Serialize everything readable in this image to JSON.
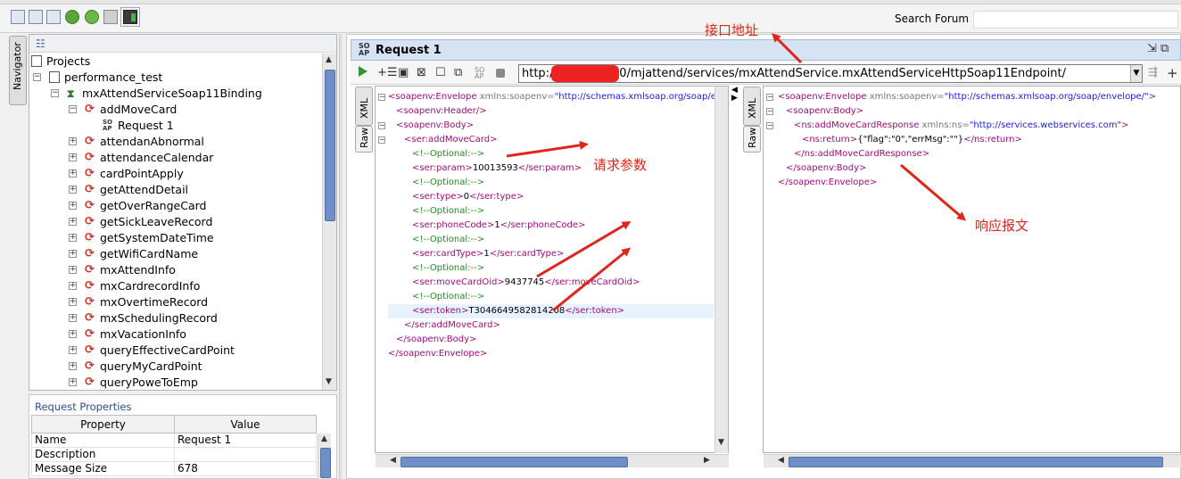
{
  "toolbar": {
    "icons": [
      "new-project-icon",
      "import-project-icon",
      "save-all-icon",
      "forum-icon",
      "sync-icon",
      "preferences-icon",
      "monitor-icon"
    ],
    "search_label": "Search Forum",
    "search_placeholder": ""
  },
  "navigator": {
    "tab_label": "Navigator",
    "tree": [
      {
        "label": "Projects",
        "level": 0,
        "icon": "projects-icon",
        "expander": ""
      },
      {
        "label": "performance_test",
        "level": 1,
        "icon": "project-icon",
        "expander": "−"
      },
      {
        "label": "mxAttendServiceSoap11Binding",
        "level": 2,
        "icon": "binding-icon",
        "expander": "−"
      },
      {
        "label": "addMoveCard",
        "level": 3,
        "icon": "operation-icon",
        "expander": "−"
      },
      {
        "label": "Request 1",
        "level": 4,
        "icon": "request-icon",
        "expander": ""
      },
      {
        "label": "attendanAbnormal",
        "level": 3,
        "icon": "operation-icon",
        "expander": "+"
      },
      {
        "label": "attendanceCalendar",
        "level": 3,
        "icon": "operation-icon",
        "expander": "+"
      },
      {
        "label": "cardPointApply",
        "level": 3,
        "icon": "operation-icon",
        "expander": "+"
      },
      {
        "label": "getAttendDetail",
        "level": 3,
        "icon": "operation-icon",
        "expander": "+"
      },
      {
        "label": "getOverRangeCard",
        "level": 3,
        "icon": "operation-icon",
        "expander": "+"
      },
      {
        "label": "getSickLeaveRecord",
        "level": 3,
        "icon": "operation-icon",
        "expander": "+"
      },
      {
        "label": "getSystemDateTime",
        "level": 3,
        "icon": "operation-icon",
        "expander": "+"
      },
      {
        "label": "getWifiCardName",
        "level": 3,
        "icon": "operation-icon",
        "expander": "+"
      },
      {
        "label": "mxAttendInfo",
        "level": 3,
        "icon": "operation-icon",
        "expander": "+"
      },
      {
        "label": "mxCardrecordInfo",
        "level": 3,
        "icon": "operation-icon",
        "expander": "+"
      },
      {
        "label": "mxOvertimeRecord",
        "level": 3,
        "icon": "operation-icon",
        "expander": "+"
      },
      {
        "label": "mxSchedulingRecord",
        "level": 3,
        "icon": "operation-icon",
        "expander": "+"
      },
      {
        "label": "mxVacationInfo",
        "level": 3,
        "icon": "operation-icon",
        "expander": "+"
      },
      {
        "label": "queryEffectiveCardPoint",
        "level": 3,
        "icon": "operation-icon",
        "expander": "+"
      },
      {
        "label": "queryMyCardPoint",
        "level": 3,
        "icon": "operation-icon",
        "expander": "+"
      },
      {
        "label": "queryPoweToEmp",
        "level": 3,
        "icon": "operation-icon",
        "expander": "+"
      }
    ]
  },
  "properties": {
    "title": "Request Properties",
    "columns": [
      "Property",
      "Value"
    ],
    "rows": [
      [
        "Name",
        "Request 1"
      ],
      [
        "Description",
        ""
      ],
      [
        "Message Size",
        "678"
      ]
    ]
  },
  "request": {
    "title": "Request 1",
    "url_prefix": "http://",
    "url_suffix": "0:8080/mjattend/services/mxAttendService.mxAttendServiceHttpSoap11Endpoint/",
    "request_tabs": [
      "XML",
      "Raw"
    ],
    "response_tabs": [
      "XML",
      "Raw"
    ],
    "request_xml": [
      {
        "indent": 0,
        "fold": "−",
        "parts": [
          {
            "t": "tag",
            "v": "<soapenv:Envelope"
          },
          {
            "t": "attr",
            "v": " xmlns:soapenv="
          },
          {
            "t": "val",
            "v": "\"http://schemas.xmlsoap.org/soap/envelope/\""
          },
          {
            "t": "tag",
            "v": ">"
          }
        ]
      },
      {
        "indent": 1,
        "fold": "",
        "parts": [
          {
            "t": "tag",
            "v": "<soapenv:Header/>"
          }
        ]
      },
      {
        "indent": 1,
        "fold": "−",
        "parts": [
          {
            "t": "tag",
            "v": "<soapenv:Body>"
          }
        ]
      },
      {
        "indent": 2,
        "fold": "−",
        "parts": [
          {
            "t": "tag",
            "v": "<ser:addMoveCard>"
          }
        ]
      },
      {
        "indent": 3,
        "fold": "",
        "parts": [
          {
            "t": "com",
            "v": "<!--Optional:-->"
          }
        ]
      },
      {
        "indent": 3,
        "fold": "",
        "parts": [
          {
            "t": "tag",
            "v": "<ser:param>"
          },
          {
            "t": "txt",
            "v": "10013593"
          },
          {
            "t": "tag",
            "v": "</ser:param>"
          }
        ]
      },
      {
        "indent": 3,
        "fold": "",
        "parts": [
          {
            "t": "com",
            "v": "<!--Optional:-->"
          }
        ]
      },
      {
        "indent": 3,
        "fold": "",
        "parts": [
          {
            "t": "tag",
            "v": "<ser:type>"
          },
          {
            "t": "txt",
            "v": "0"
          },
          {
            "t": "tag",
            "v": "</ser:type>"
          }
        ]
      },
      {
        "indent": 3,
        "fold": "",
        "parts": [
          {
            "t": "com",
            "v": "<!--Optional:-->"
          }
        ]
      },
      {
        "indent": 3,
        "fold": "",
        "parts": [
          {
            "t": "tag",
            "v": "<ser:phoneCode>"
          },
          {
            "t": "txt",
            "v": "1"
          },
          {
            "t": "tag",
            "v": "</ser:phoneCode>"
          }
        ]
      },
      {
        "indent": 3,
        "fold": "",
        "parts": [
          {
            "t": "com",
            "v": "<!--Optional:-->"
          }
        ]
      },
      {
        "indent": 3,
        "fold": "",
        "parts": [
          {
            "t": "tag",
            "v": "<ser:cardType>"
          },
          {
            "t": "txt",
            "v": "1"
          },
          {
            "t": "tag",
            "v": "</ser:cardType>"
          }
        ]
      },
      {
        "indent": 3,
        "fold": "",
        "parts": [
          {
            "t": "com",
            "v": "<!--Optional:-->"
          }
        ]
      },
      {
        "indent": 3,
        "fold": "",
        "parts": [
          {
            "t": "tag",
            "v": "<ser:moveCardOid>"
          },
          {
            "t": "txt",
            "v": "9437745"
          },
          {
            "t": "tag",
            "v": "</ser:moveCardOid>"
          }
        ]
      },
      {
        "indent": 3,
        "fold": "",
        "parts": [
          {
            "t": "com",
            "v": "<!--Optional:-->"
          }
        ]
      },
      {
        "indent": 3,
        "fold": "",
        "hl": true,
        "parts": [
          {
            "t": "tag",
            "v": "<ser:token>"
          },
          {
            "t": "txt",
            "v": "T3046649582814208"
          },
          {
            "t": "tag",
            "v": "</ser:token>"
          }
        ]
      },
      {
        "indent": 2,
        "fold": "",
        "parts": [
          {
            "t": "tag",
            "v": "</ser:addMoveCard>"
          }
        ]
      },
      {
        "indent": 1,
        "fold": "",
        "parts": [
          {
            "t": "tag",
            "v": "</soapenv:Body>"
          }
        ]
      },
      {
        "indent": 0,
        "fold": "",
        "parts": [
          {
            "t": "tag",
            "v": "</soapenv:Envelope>"
          }
        ]
      }
    ],
    "response_xml": [
      {
        "indent": 0,
        "fold": "−",
        "parts": [
          {
            "t": "tag",
            "v": "<soapenv:Envelope"
          },
          {
            "t": "attr",
            "v": " xmlns:soapenv="
          },
          {
            "t": "val",
            "v": "\"http://schemas.xmlsoap.org/soap/envelope/\""
          },
          {
            "t": "tag",
            "v": ">"
          }
        ]
      },
      {
        "indent": 1,
        "fold": "−",
        "parts": [
          {
            "t": "tag",
            "v": "<soapenv:Body>"
          }
        ]
      },
      {
        "indent": 2,
        "fold": "−",
        "parts": [
          {
            "t": "tag",
            "v": "<ns:addMoveCardResponse"
          },
          {
            "t": "attr",
            "v": " xmlns:ns="
          },
          {
            "t": "val",
            "v": "\"http://services.webservices.com\""
          },
          {
            "t": "tag",
            "v": ">"
          }
        ]
      },
      {
        "indent": 3,
        "fold": "",
        "parts": [
          {
            "t": "tag",
            "v": "<ns:return>"
          },
          {
            "t": "txt",
            "v": "{\"flag\":\"0\",\"errMsg\":\"\"}"
          },
          {
            "t": "tag",
            "v": "</ns:return>"
          }
        ]
      },
      {
        "indent": 2,
        "fold": "",
        "parts": [
          {
            "t": "tag",
            "v": "</ns:addMoveCardResponse>"
          }
        ]
      },
      {
        "indent": 1,
        "fold": "",
        "parts": [
          {
            "t": "tag",
            "v": "</soapenv:Body>"
          }
        ]
      },
      {
        "indent": 0,
        "fold": "",
        "parts": [
          {
            "t": "tag",
            "v": "</soapenv:Envelope>"
          }
        ]
      }
    ]
  },
  "annotations": {
    "endpoint": "接口地址",
    "params": "请求参数",
    "response": "响应报文",
    "color": "#e0251b"
  }
}
